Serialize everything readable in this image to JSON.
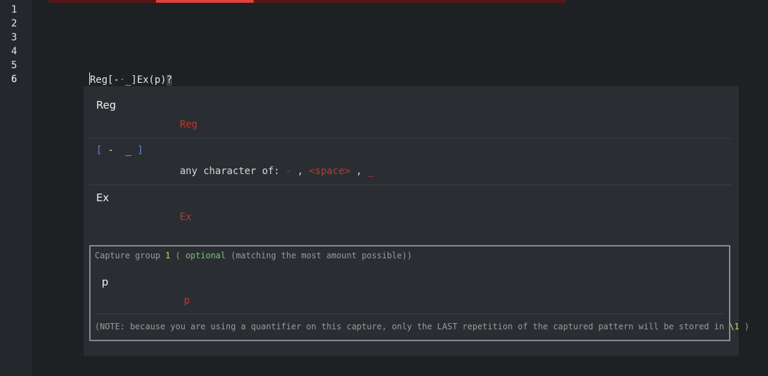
{
  "gutter": {
    "lines": [
      "1",
      "2",
      "3",
      "4",
      "5",
      "6"
    ],
    "current_line": "6"
  },
  "editor": {
    "code_before_cursor": "",
    "code": {
      "p1": "Reg[-",
      "p2": "·",
      "p3": "_]Ex(p)",
      "p4": "?"
    }
  },
  "popup": {
    "sections": [
      {
        "title": "Reg",
        "detail": "Reg"
      },
      {
        "title_parts": [
          "[",
          " - ",
          "_",
          " ]"
        ],
        "detail_prefix": "any character of: ",
        "items": [
          "-",
          "<space>",
          "_"
        ],
        "sep": " , "
      },
      {
        "title": "Ex",
        "detail": "Ex"
      }
    ],
    "group": {
      "head_prefix": "Capture group ",
      "number": "1",
      "paren_open": " ( ",
      "optional": "optional",
      "head_suffix": " (matching the most amount possible))",
      "char": "p",
      "char_detail": "p",
      "note_prefix": "(NOTE: because you are using a quantifier on this capture, only the LAST repetition of the captured pattern will be stored in ",
      "note_ref": "\\1",
      "note_suffix": " )"
    }
  },
  "colors": {
    "accent_red": "#e0413a",
    "match_red": "#c0392b",
    "bracket_blue": "#6f7fd8",
    "number_yellow": "#d6d664",
    "optional_green": "#7fc46d"
  }
}
